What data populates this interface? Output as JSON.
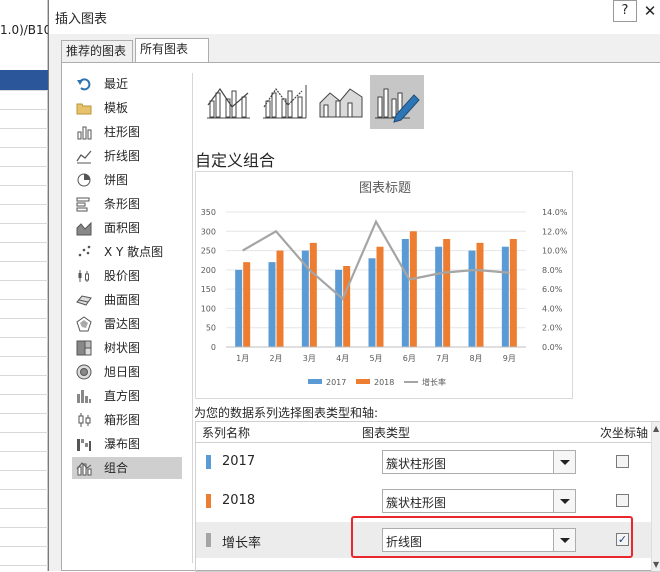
{
  "background": {
    "formula_text": "1.0)/B10"
  },
  "dialog": {
    "title": "插入图表",
    "help": "?",
    "close": "✕"
  },
  "tabs": [
    {
      "label": "推荐的图表"
    },
    {
      "label": "所有图表"
    }
  ],
  "sidebar": {
    "items": [
      {
        "label": "最近",
        "icon": "undo-arrow-icon"
      },
      {
        "label": "模板",
        "icon": "folder-icon"
      },
      {
        "label": "柱形图",
        "icon": "column-chart-icon"
      },
      {
        "label": "折线图",
        "icon": "line-chart-icon"
      },
      {
        "label": "饼图",
        "icon": "pie-chart-icon"
      },
      {
        "label": "条形图",
        "icon": "bar-chart-icon"
      },
      {
        "label": "面积图",
        "icon": "area-chart-icon"
      },
      {
        "label": "X Y 散点图",
        "icon": "scatter-chart-icon"
      },
      {
        "label": "股价图",
        "icon": "stock-chart-icon"
      },
      {
        "label": "曲面图",
        "icon": "surface-chart-icon"
      },
      {
        "label": "雷达图",
        "icon": "radar-chart-icon"
      },
      {
        "label": "树状图",
        "icon": "treemap-chart-icon"
      },
      {
        "label": "旭日图",
        "icon": "sunburst-chart-icon"
      },
      {
        "label": "直方图",
        "icon": "histogram-chart-icon"
      },
      {
        "label": "箱形图",
        "icon": "box-whisker-chart-icon"
      },
      {
        "label": "瀑布图",
        "icon": "waterfall-chart-icon"
      },
      {
        "label": "组合",
        "icon": "combo-chart-icon"
      }
    ],
    "selected": "组合"
  },
  "combo_title": "自定义组合",
  "series_section": {
    "label": "为您的数据系列选择图表类型和轴:",
    "headers": {
      "name": "系列名称",
      "type": "图表类型",
      "secondary": "次坐标轴"
    },
    "rows": [
      {
        "name": "2017",
        "color": "#5b9bd5",
        "type": "簇状柱形图",
        "secondary": false
      },
      {
        "name": "2018",
        "color": "#ed7d31",
        "type": "簇状柱形图",
        "secondary": false
      },
      {
        "name": "增长率",
        "color": "#a5a5a5",
        "type": "折线图",
        "secondary": true
      }
    ]
  },
  "chart_data": {
    "type": "combo",
    "title": "图表标题",
    "categories": [
      "1月",
      "2月",
      "3月",
      "4月",
      "5月",
      "6月",
      "7月",
      "8月",
      "9月"
    ],
    "series": [
      {
        "name": "2017",
        "type": "bar",
        "axis": "primary",
        "color": "#5b9bd5",
        "values": [
          200,
          220,
          250,
          200,
          230,
          280,
          260,
          250,
          260
        ]
      },
      {
        "name": "2018",
        "type": "bar",
        "axis": "primary",
        "color": "#ed7d31",
        "values": [
          220,
          250,
          270,
          210,
          260,
          300,
          280,
          270,
          280
        ]
      },
      {
        "name": "增长率",
        "type": "line",
        "axis": "secondary",
        "color": "#a5a5a5",
        "values": [
          0.1,
          0.12,
          0.08,
          0.05,
          0.13,
          0.07,
          0.077,
          0.08,
          0.077
        ]
      }
    ],
    "ylim": [
      0,
      350
    ],
    "y_ticks": [
      "350",
      "300",
      "250",
      "200",
      "150",
      "100",
      "50",
      "0"
    ],
    "y2lim": [
      0,
      0.14
    ],
    "y2_ticks": [
      "14.0%",
      "12.0%",
      "10.0%",
      "8.0%",
      "6.0%",
      "4.0%",
      "2.0%",
      "0.0%"
    ],
    "legend": [
      "2017",
      "2018",
      "增长率"
    ],
    "legend_position": "bottom",
    "grid": true
  }
}
